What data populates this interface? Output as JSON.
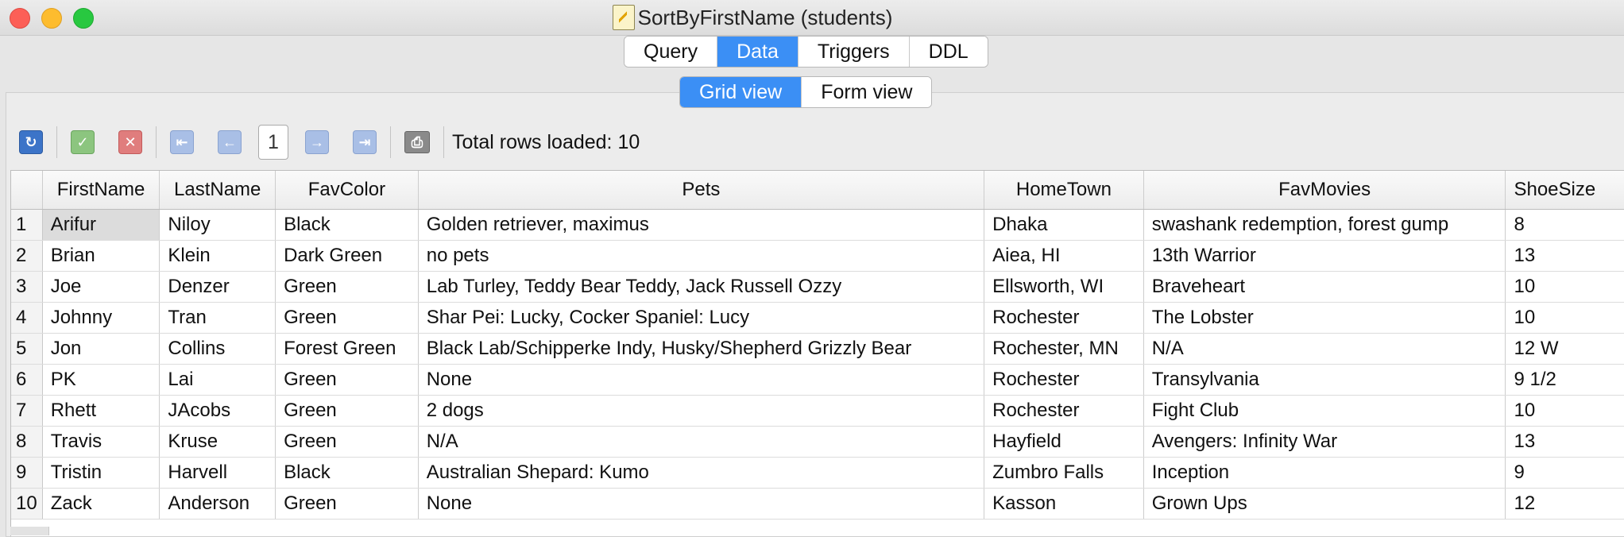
{
  "window": {
    "title": "SortByFirstName (students)"
  },
  "top_tabs": [
    {
      "label": "Query",
      "active": false
    },
    {
      "label": "Data",
      "active": true
    },
    {
      "label": "Triggers",
      "active": false
    },
    {
      "label": "DDL",
      "active": false
    }
  ],
  "view_tabs": [
    {
      "label": "Grid view",
      "active": true
    },
    {
      "label": "Form view",
      "active": false
    }
  ],
  "toolbar": {
    "icons": [
      "refresh-icon",
      "commit-check-icon",
      "rollback-cancel-icon",
      "first-page-icon",
      "previous-page-icon",
      "next-page-icon",
      "last-page-icon",
      "print-icon"
    ],
    "page_number": "1",
    "total_rows_label": "Total rows loaded: 10"
  },
  "accent_color": "#3b8ff5",
  "grid": {
    "columns": [
      "FirstName",
      "LastName",
      "FavColor",
      "Pets",
      "HomeTown",
      "FavMovies",
      "ShoeSize"
    ],
    "rows": [
      {
        "n": "1",
        "cells": [
          "Arifur",
          "Niloy",
          "Black",
          "Golden retriever, maximus",
          "Dhaka",
          " swashank redemption, forest gump",
          "8"
        ]
      },
      {
        "n": "2",
        "cells": [
          "Brian",
          "Klein",
          "Dark Green",
          "no pets",
          "Aiea, HI",
          "13th Warrior",
          "13"
        ]
      },
      {
        "n": "3",
        "cells": [
          "Joe",
          "Denzer",
          "Green",
          "Lab Turley, Teddy Bear Teddy, Jack Russell Ozzy",
          "Ellsworth, WI",
          "Braveheart",
          "10"
        ]
      },
      {
        "n": "4",
        "cells": [
          "Johnny",
          "Tran",
          "Green",
          "Shar Pei: Lucky, Cocker Spaniel: Lucy",
          "Rochester",
          "The Lobster",
          "10"
        ]
      },
      {
        "n": "5",
        "cells": [
          "Jon",
          "Collins",
          "Forest Green",
          "Black Lab/Schipperke Indy, Husky/Shepherd Grizzly Bear",
          "Rochester, MN",
          "N/A",
          "12 W"
        ]
      },
      {
        "n": "6",
        "cells": [
          "PK",
          "Lai",
          "Green",
          "None",
          "Rochester",
          "Transylvania",
          "9 1/2"
        ]
      },
      {
        "n": "7",
        "cells": [
          "Rhett",
          "JAcobs",
          "Green",
          "2 dogs",
          "Rochester",
          "Fight Club",
          "10"
        ]
      },
      {
        "n": "8",
        "cells": [
          "Travis",
          "Kruse",
          "Green",
          "N/A",
          "Hayfield",
          "Avengers: Infinity War",
          "13"
        ]
      },
      {
        "n": "9",
        "cells": [
          "Tristin",
          "Harvell",
          "Black",
          "Australian Shepard: Kumo",
          "Zumbro Falls",
          "Inception",
          "9"
        ]
      },
      {
        "n": "10",
        "cells": [
          "Zack",
          "Anderson",
          "Green",
          "None",
          "Kasson",
          "Grown Ups",
          "12"
        ]
      }
    ],
    "selected_cell": {
      "row": 1,
      "column": "FirstName"
    }
  }
}
